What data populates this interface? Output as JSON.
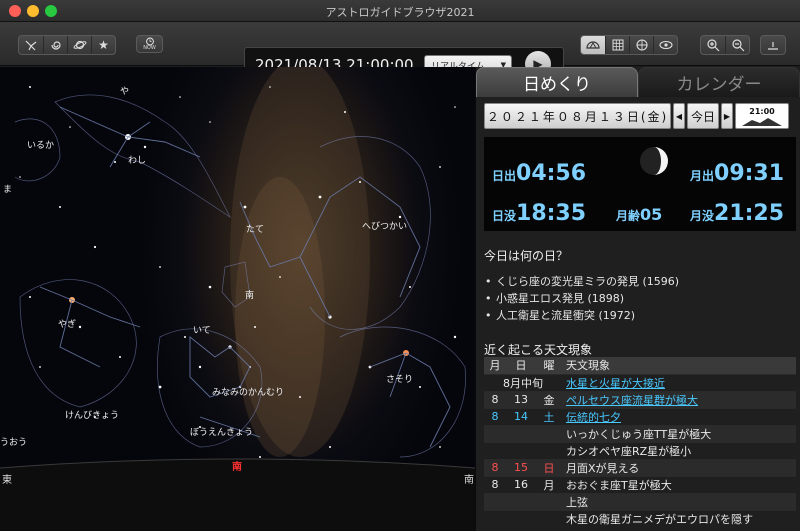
{
  "window": {
    "title": "アストロガイドブラウザ2021"
  },
  "toolbar": {
    "left_icons": [
      "constellation-lines-icon",
      "galaxy-icon",
      "planet-icon",
      "star-icon"
    ],
    "now_label": "NOW",
    "datetime": "2021/08/13 21:00:00",
    "mode_select": "リアルタイム",
    "view_icons": [
      "horizon-view-icon",
      "grid-icon",
      "equatorial-icon",
      "eye-icon"
    ],
    "zoom_icons": [
      "zoom-in-icon",
      "zoom-out-icon"
    ]
  },
  "sky": {
    "constellations": [
      "や",
      "いるか",
      "わし",
      "たて",
      "へびつかい",
      "ま",
      "やぎ",
      "いて",
      "南",
      "みなみのかんむり",
      "さそり",
      "けんびきょう",
      "ぼうえんきょう",
      "うおう"
    ],
    "compass": {
      "south": "南",
      "left": "東",
      "right": "南"
    }
  },
  "panel": {
    "tabs": [
      "日めくり",
      "カレンダー"
    ],
    "date": "２０２１年０８月１３日(金)",
    "today_label": "今日",
    "time_btn": "21:00",
    "sun_moon": {
      "sunrise_label": "日出",
      "sunrise": "04:56",
      "sunset_label": "日没",
      "sunset": "18:35",
      "moonrise_label": "月出",
      "moonrise": "09:31",
      "moonset_label": "月没",
      "moonset": "21:25",
      "moonage_label": "月齢",
      "moonage": "05"
    },
    "anniv_title": "今日は何の日？",
    "anniversaries": [
      "くじら座の変光星ミラの発見 (1596)",
      "小惑星エロス発見 (1898)",
      "人工衛星と流星衝突 (1972)"
    ],
    "events_title": "近く起こる天文現象",
    "events_headers": [
      "月",
      "日",
      "曜",
      "天文現象"
    ],
    "events": [
      {
        "m": "",
        "d": "8月中旬",
        "w": "",
        "ev": "水星と火星が大接近",
        "link": true,
        "color": ""
      },
      {
        "m": "8",
        "d": "13",
        "w": "金",
        "ev": "ペルセウス座流星群が極大",
        "link": true,
        "color": ""
      },
      {
        "m": "8",
        "d": "14",
        "w": "土",
        "ev": "伝統的七夕",
        "link": true,
        "color": "blue"
      },
      {
        "m": "",
        "d": "",
        "w": "",
        "ev": "いっかくじゅう座TT星が極大",
        "link": false,
        "color": ""
      },
      {
        "m": "",
        "d": "",
        "w": "",
        "ev": "カシオペヤ座RZ星が極小",
        "link": false,
        "color": ""
      },
      {
        "m": "8",
        "d": "15",
        "w": "日",
        "ev": "月面Xが見える",
        "link": false,
        "color": "red"
      },
      {
        "m": "8",
        "d": "16",
        "w": "月",
        "ev": "おおぐま座T星が極大",
        "link": false,
        "color": ""
      },
      {
        "m": "",
        "d": "",
        "w": "",
        "ev": "上弦",
        "link": false,
        "color": ""
      },
      {
        "m": "",
        "d": "",
        "w": "",
        "ev": "木星の衛星ガニメデがエウロパを隠す",
        "link": false,
        "color": ""
      }
    ]
  }
}
